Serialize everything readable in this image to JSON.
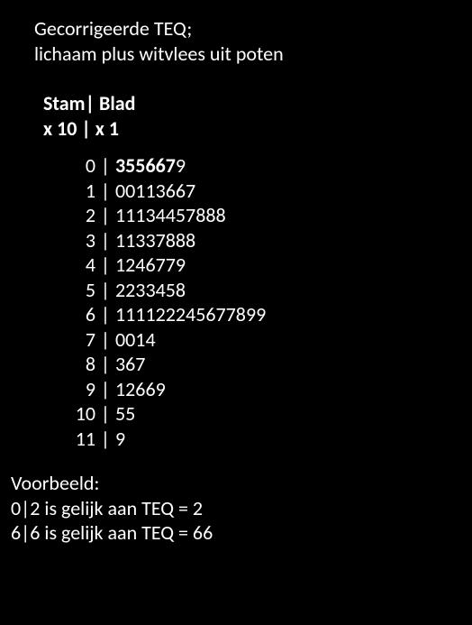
{
  "title_line1": "Gecorrigeerde TEQ;",
  "title_line2": "lichaam plus witvlees uit poten",
  "header_line1": "Stam| Blad",
  "header_line2": "x 10 | x 1",
  "separator": "|",
  "rows": {
    "r0": {
      "stem": "0",
      "leaf_bold": "355667",
      "leaf_rest": "9"
    },
    "r1": {
      "stem": "1",
      "leaf": "00113667"
    },
    "r2": {
      "stem": "2",
      "leaf": "11134457888"
    },
    "r3": {
      "stem": "3",
      "leaf": "11337888"
    },
    "r4": {
      "stem": "4",
      "leaf": "1246779"
    },
    "r5": {
      "stem": "5",
      "leaf": "2233458"
    },
    "r6": {
      "stem": "6",
      "leaf": "111122245677899"
    },
    "r7": {
      "stem": "7",
      "leaf": "0014"
    },
    "r8": {
      "stem": "8",
      "leaf": "367"
    },
    "r9": {
      "stem": "9",
      "leaf": "12669"
    },
    "r10": {
      "stem": "10",
      "leaf": "55"
    },
    "r11": {
      "stem": "11",
      "leaf": "9"
    }
  },
  "example_heading": "Voorbeeld:",
  "example1": "0|2  is gelijk aan TEQ = 2",
  "example2": "6|6 is gelijk aan  TEQ = 66",
  "chart_data": {
    "type": "stem-and-leaf",
    "title": "Gecorrigeerde TEQ; lichaam plus witvlees uit poten",
    "stem_unit": 10,
    "leaf_unit": 1,
    "stem_label": "Stam",
    "leaf_label": "Blad",
    "rows": [
      {
        "stem": 0,
        "leaves": [
          3,
          5,
          5,
          6,
          6,
          7,
          9
        ]
      },
      {
        "stem": 1,
        "leaves": [
          0,
          0,
          1,
          1,
          3,
          6,
          6,
          7
        ]
      },
      {
        "stem": 2,
        "leaves": [
          1,
          1,
          1,
          3,
          4,
          4,
          5,
          7,
          8,
          8,
          8
        ]
      },
      {
        "stem": 3,
        "leaves": [
          1,
          1,
          3,
          3,
          7,
          8,
          8,
          8
        ]
      },
      {
        "stem": 4,
        "leaves": [
          1,
          2,
          4,
          6,
          7,
          7,
          9
        ]
      },
      {
        "stem": 5,
        "leaves": [
          2,
          2,
          3,
          3,
          4,
          5,
          8
        ]
      },
      {
        "stem": 6,
        "leaves": [
          1,
          1,
          1,
          1,
          2,
          2,
          2,
          4,
          5,
          6,
          7,
          7,
          8,
          9,
          9
        ]
      },
      {
        "stem": 7,
        "leaves": [
          0,
          0,
          1,
          4
        ]
      },
      {
        "stem": 8,
        "leaves": [
          3,
          6,
          7
        ]
      },
      {
        "stem": 9,
        "leaves": [
          1,
          2,
          6,
          6,
          9
        ]
      },
      {
        "stem": 10,
        "leaves": [
          5,
          5
        ]
      },
      {
        "stem": 11,
        "leaves": [
          9
        ]
      }
    ],
    "examples": [
      {
        "notation": "0|2",
        "value": 2
      },
      {
        "notation": "6|6",
        "value": 66
      }
    ]
  }
}
